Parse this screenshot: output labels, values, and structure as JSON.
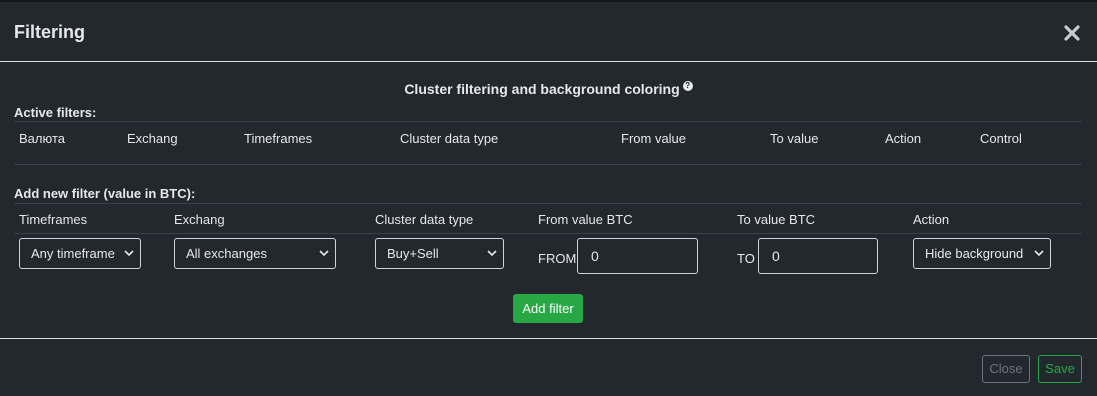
{
  "modal": {
    "title": "Filtering",
    "close_icon": "close-icon"
  },
  "section": {
    "title": "Cluster filtering and background coloring",
    "help_icon": "question-circle-icon",
    "help_glyph": "?"
  },
  "active_filters": {
    "label": "Active filters:",
    "columns": [
      "Валюта",
      "Exchang",
      "Timeframes",
      "Cluster data type",
      "From value",
      "To value",
      "Action",
      "Control"
    ]
  },
  "new_filter": {
    "label": "Add new filter (value in BTC):",
    "columns": [
      "Timeframes",
      "Exchang",
      "Cluster data type",
      "From value BTC",
      "To value BTC",
      "Action"
    ],
    "timeframe_select": "Any timeframe",
    "exchange_select": "All exchanges",
    "data_type_select": "Buy+Sell",
    "from_prefix": "FROM",
    "from_value": "0",
    "to_prefix": "TO",
    "to_value": "0",
    "action_select": "Hide background",
    "add_button": "Add filter"
  },
  "footer": {
    "close_button": "Close",
    "save_button": "Save"
  },
  "colors": {
    "background": "#23282e",
    "success": "#28a745",
    "secondary": "#6c757d"
  }
}
